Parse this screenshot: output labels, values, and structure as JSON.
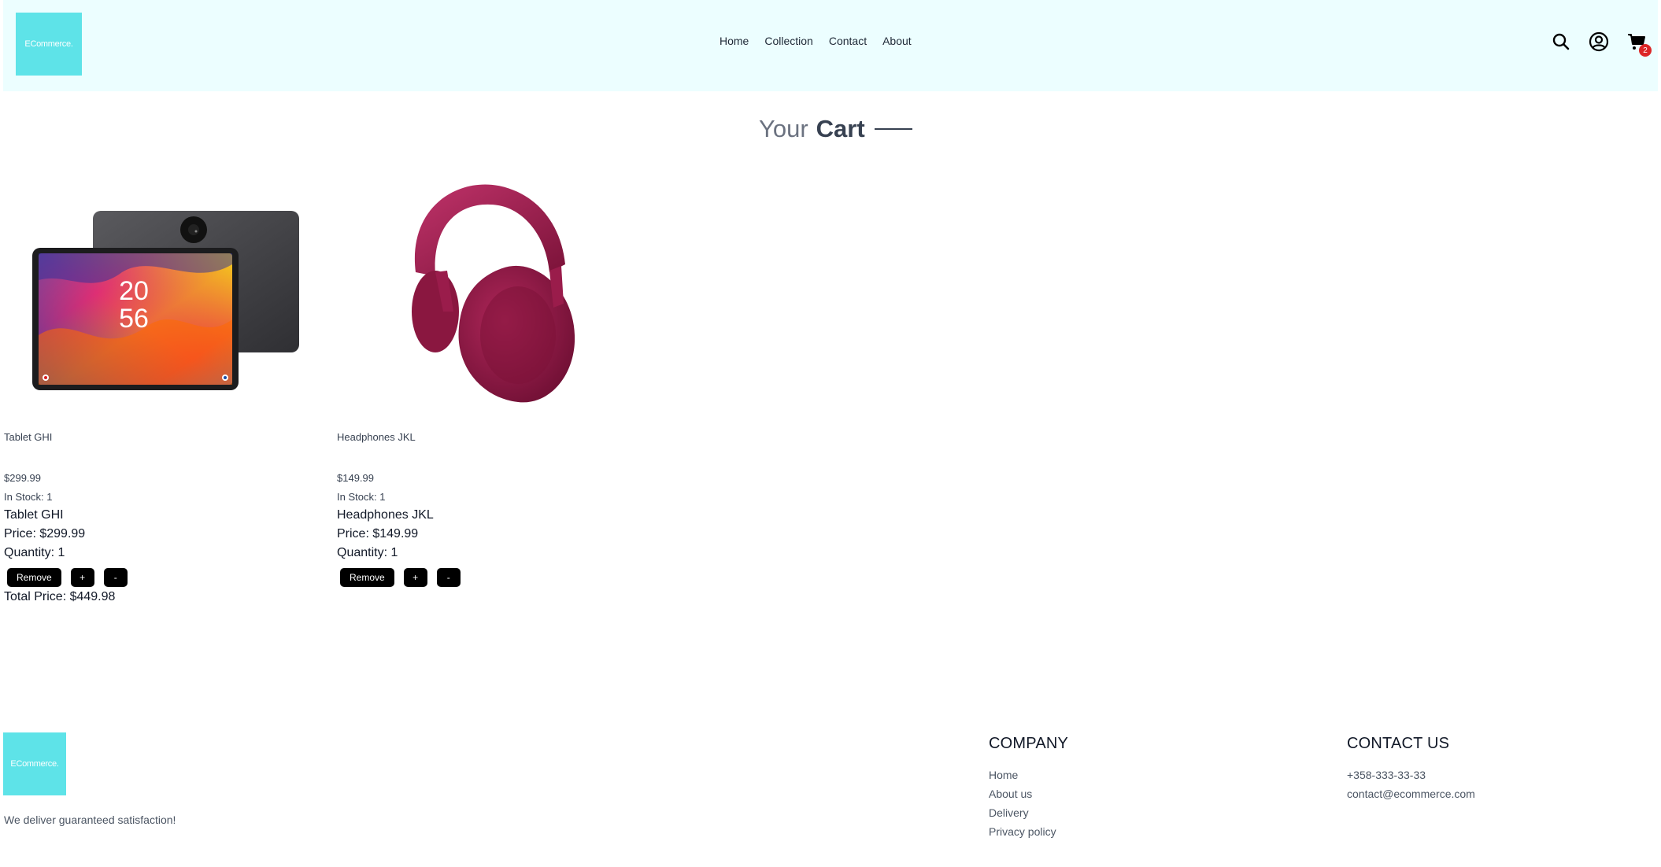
{
  "brand": {
    "logo_text": "ECommerce."
  },
  "nav": {
    "items": [
      "Home",
      "Collection",
      "Contact",
      "About"
    ]
  },
  "header": {
    "cart_count": "2",
    "icons": [
      "search-icon",
      "user-icon",
      "cart-icon"
    ]
  },
  "page_title": {
    "part1": "Your",
    "part2": "Cart"
  },
  "cart": {
    "items": [
      {
        "name_small": "Tablet GHI",
        "price_small": "$299.99",
        "stock": "In Stock: 1",
        "name_big": "Tablet GHI",
        "price_big": "Price: $299.99",
        "quantity": "Quantity: 1",
        "remove_label": "Remove",
        "plus_label": "+",
        "minus_label": "-"
      },
      {
        "name_small": "Headphones JKL",
        "price_small": "$149.99",
        "stock": "In Stock: 1",
        "name_big": "Headphones JKL",
        "price_big": "Price: $149.99",
        "quantity": "Quantity: 1",
        "remove_label": "Remove",
        "plus_label": "+",
        "minus_label": "-"
      }
    ],
    "total": "Total Price: $449.98",
    "tablet_screen_time": [
      "20",
      "56"
    ]
  },
  "footer": {
    "logo_text": "ECommerce.",
    "tagline": "We deliver guaranteed satisfaction!",
    "company": {
      "heading": "COMPANY",
      "links": [
        "Home",
        "About us",
        "Delivery",
        "Privacy policy"
      ]
    },
    "contact": {
      "heading": "CONTACT US",
      "phone": "+358-333-33-33",
      "email": "contact@ecommerce.com"
    }
  },
  "colors": {
    "header_bg": "#ecfeff",
    "logo_bg": "#5ee3e8",
    "badge": "#dc2626",
    "button": "#000000"
  }
}
